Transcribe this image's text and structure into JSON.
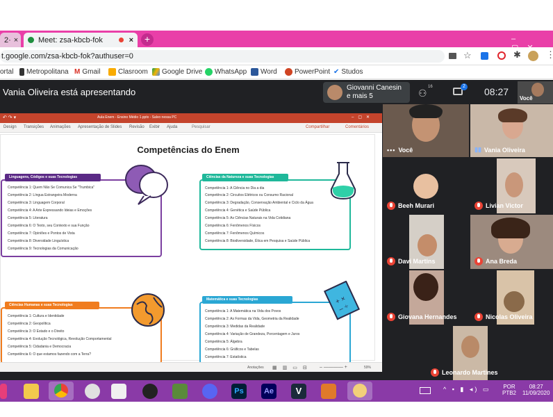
{
  "browser": {
    "tab_prev": "2·",
    "tab_title": "Meet: zsa-kbcb-fok",
    "tab_close": "×",
    "new_tab": "+",
    "url": "t.google.com/zsa-kbcb-fok?authuser=0",
    "bookmarks": [
      "ortal",
      "Metropolitana",
      "Gmail",
      "Clasroom",
      "Google Drive",
      "WhatsApp",
      "Word",
      "PowerPoint",
      "Studos"
    ]
  },
  "meet": {
    "presenting": "Vania Oliveira está apresentando",
    "participants_popup": {
      "name": "Giovanni Canesin",
      "more": "e mais 5"
    },
    "people_count": "16",
    "chat_count": "2",
    "time": "08:27",
    "self_label": "Você",
    "tiles": [
      "Você",
      "Vania Oliveira",
      "Beeh Murari",
      "Livian Victor",
      "Davi Martins",
      "Ana Breda",
      "Giovana Hernandes",
      "Nicolas Oliveira",
      "Leonardo Martines"
    ]
  },
  "slide": {
    "window_title": "Aula Enem - Ensino Médio 1.pptx - Salvo nessa PC",
    "menu": [
      "Design",
      "Transições",
      "Animações",
      "Apresentação de Slides",
      "Revisão",
      "Exibir",
      "Ajuda",
      "Pesquisar"
    ],
    "share": "Compartilhar",
    "comments": "Comentários",
    "title": "Competências do Enem",
    "boxes": [
      {
        "head": "Linguagens, Códigos e suas Tecnologias",
        "color": "#5b2a86",
        "items": [
          "Competência 1: Quem Não Se Comunica Se \"Trumbica\"",
          "Competência 2: Língua Estrangeira Moderna",
          "Competência 3: Linguagem Corporal",
          "Competência 4: A Arte Expressando Ideias e Emoções",
          "Competência 5: Literatura",
          "Competência 6: O Texto, seu Contexto e sua Função",
          "Competência 7: Opiniões e Pontos de Vista",
          "Competência 8: Diversidade Linguística",
          "Competência 9: Tecnologias da Comunicação"
        ]
      },
      {
        "head": "Ciências da Natureza e suas Tecnologias",
        "color": "#1fb89a",
        "items": [
          "Competência 1: A Ciência no Dia a dia",
          "Competência 2: Circuitos Elétricos ou Consumo Racional",
          "Competência 3: Degradação, Conservação Ambiental e Ciclo da Água",
          "Competência 4: Genética e Saúde Pública",
          "Competência 5: As Ciências Naturais na Vida Cotidiana",
          "Competência 6: Fenômenos Físicos",
          "Competência 7: Fenômenos Químicos",
          "Competência 8: Biodiversidade, Ética em Pesquisa e Saúde Pública"
        ]
      },
      {
        "head": "Ciências Humanas e suas Tecnologias",
        "color": "#f07c1e",
        "items": [
          "Competência 1: Cultura e Identidade",
          "Competência 2: Geopolítica",
          "Competência 3: O Estado e o Direito",
          "Competência 4: Evolução Tecnológica, Revolução Comportamental",
          "Competência 5: Cidadania e Democracia",
          "Competência 6: O que estamos fazendo com a Terra?"
        ]
      },
      {
        "head": "Matemática e suas Tecnologias",
        "color": "#2aa7d4",
        "items": [
          "Competência 1: A Matemática na Vida dos Povos",
          "Competência 2: As Formas da Vida, Geometria da Realidade",
          "Competência 3: Medidas da Realidade",
          "Competência 4: Variação de Grandeza, Porcentagem e Juros",
          "Competência 5: Álgebra",
          "Competência 6: Gráficos e Tabelas",
          "Competência 7: Estatística"
        ]
      }
    ],
    "status_left": "Anotações",
    "zoom": "59%"
  },
  "taskbar": {
    "lang": "POR",
    "layout": "PTB2",
    "time": "08:27",
    "date": "11/09/2020",
    "app_ps": "Ps",
    "app_ae": "Ae",
    "app_v": "V"
  }
}
